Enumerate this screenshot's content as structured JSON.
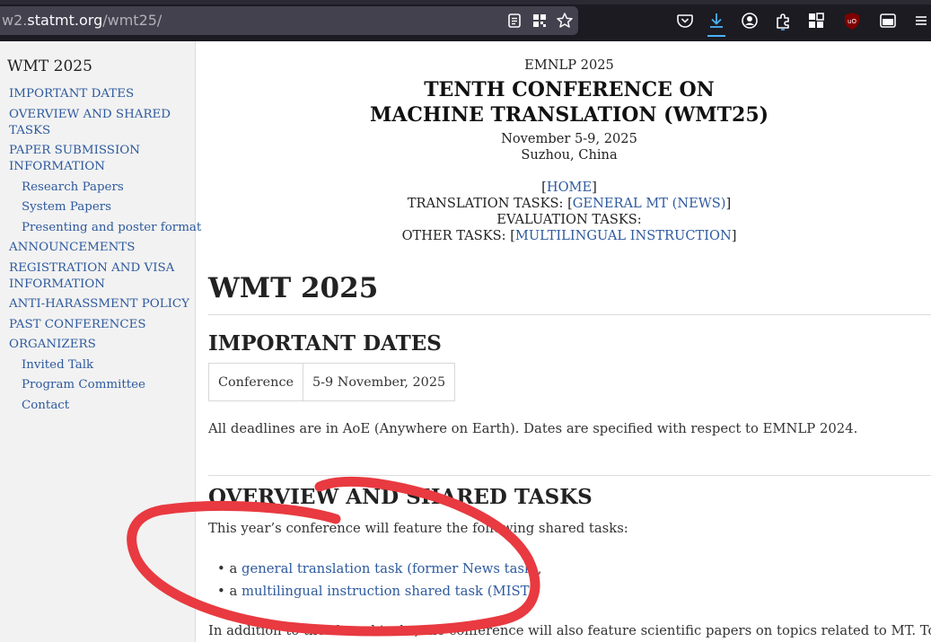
{
  "browser": {
    "url_prefix": "w2.",
    "url_host": "statmt.org",
    "url_path": "/wmt25/",
    "icons": [
      "reader-view-icon",
      "qr-code-icon",
      "bookmark-star-icon",
      "pocket-icon",
      "download-icon",
      "account-icon",
      "extensions-icon",
      "addons-icon",
      "ublock-icon",
      "sidebar-icon",
      "menu-icon"
    ],
    "ublock_badge": "uO",
    "download_accent": "#4cb2f7"
  },
  "sidebar": {
    "title": "WMT 2025",
    "items": [
      {
        "label": "IMPORTANT DATES"
      },
      {
        "label": "OVERVIEW AND SHARED"
      },
      {
        "label": "TASKS"
      },
      {
        "label": "PAPER SUBMISSION"
      },
      {
        "label": "INFORMATION"
      },
      {
        "label": "Research Papers"
      },
      {
        "label": "System Papers"
      },
      {
        "label": "Presenting and poster format"
      },
      {
        "label": "ANNOUNCEMENTS"
      },
      {
        "label": "REGISTRATION AND VISA"
      },
      {
        "label": "INFORMATION"
      },
      {
        "label": "ANTI-HARASSMENT POLICY"
      },
      {
        "label": "PAST CONFERENCES"
      },
      {
        "label": "ORGANIZERS"
      },
      {
        "label": "Invited Talk"
      },
      {
        "label": "Program Committee"
      },
      {
        "label": "Contact"
      }
    ]
  },
  "header": {
    "venue": "EMNLP 2025",
    "title_line1": "TENTH CONFERENCE ON",
    "title_line2": "MACHINE TRANSLATION (WMT25)",
    "dates": "November 5-9, 2025",
    "location": "Suzhou, China",
    "home_link": "HOME",
    "translation_tasks_label": "TRANSLATION TASKS: ",
    "general_mt_link": "GENERAL MT (NEWS)",
    "evaluation_tasks_label": "EVALUATION TASKS:",
    "other_tasks_label": "OTHER TASKS: ",
    "multilingual_link": "MULTILINGUAL INSTRUCTION",
    "open_bracket": "[",
    "close_bracket": "]"
  },
  "main": {
    "heading": "WMT 2025",
    "important_dates_heading": "IMPORTANT DATES",
    "dates_table": [
      {
        "event": "Conference",
        "date": "5-9 November, 2025"
      }
    ],
    "deadline_note": "All deadlines are in AoE (Anywhere on Earth). Dates are specified with respect to EMNLP 2024.",
    "overview_heading": "OVERVIEW AND SHARED TASKS",
    "overview_intro": "This year’s conference will feature the following shared tasks:",
    "tasks": [
      {
        "prefix": "a ",
        "link": "general translation task (former News task)",
        "suffix": ","
      },
      {
        "prefix": "a ",
        "link": "multilingual instruction shared task (MIST)",
        "suffix": ","
      }
    ],
    "bullet": "•",
    "additional": "In addition to the shared tasks, the conference will also feature scientific papers on topics related to MT. Topics of"
  },
  "annotation": {
    "color": "#e83a40"
  }
}
